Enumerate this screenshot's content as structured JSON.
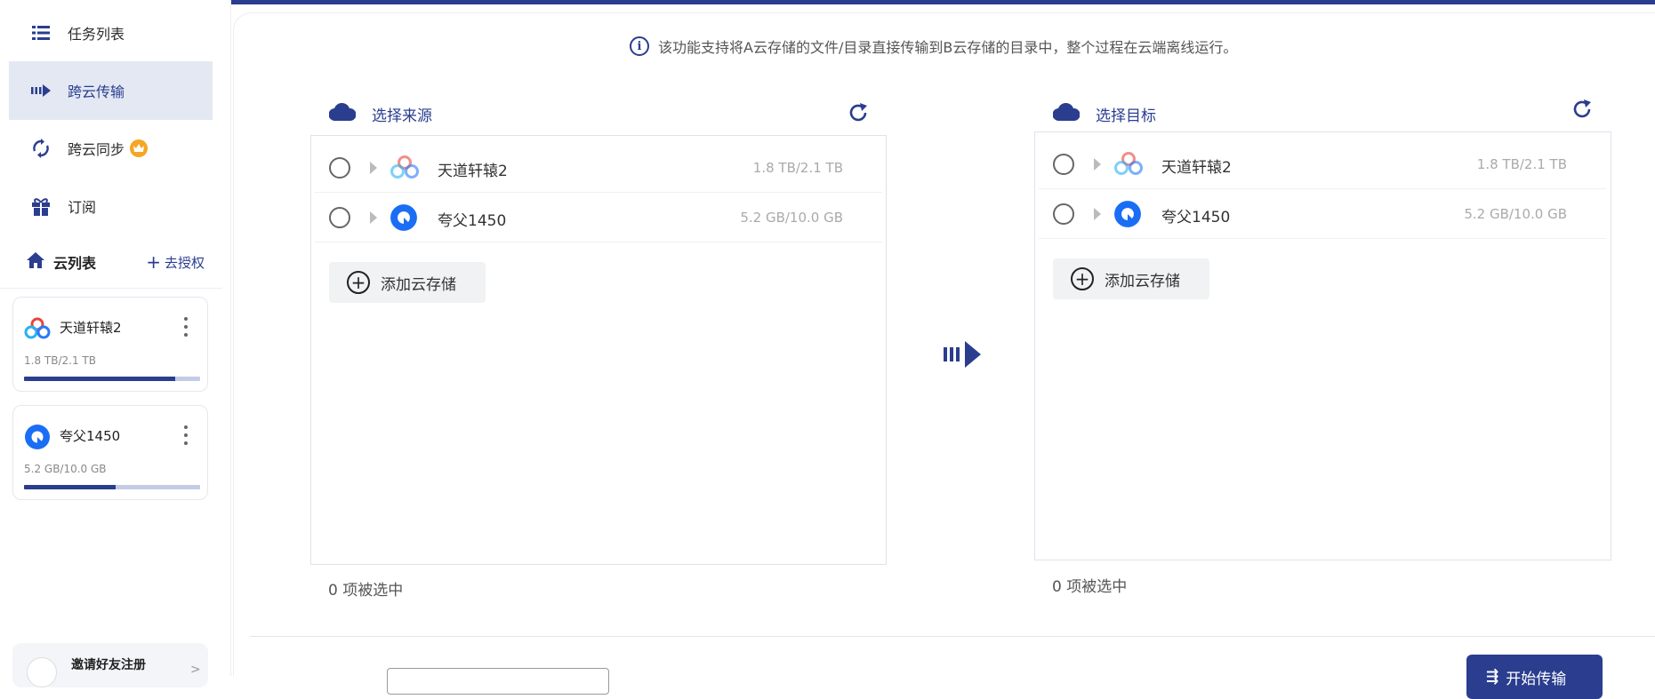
{
  "sidebar": {
    "nav": [
      {
        "label": "任务列表",
        "icon": "task-list-icon"
      },
      {
        "label": "跨云传输",
        "icon": "transfer-icon",
        "active": true
      },
      {
        "label": "跨云同步",
        "icon": "sync-icon",
        "badge": "crown-icon"
      },
      {
        "label": "订阅",
        "icon": "gift-icon"
      }
    ],
    "cloud_list": {
      "title": "云列表",
      "auth_link": "去授权"
    },
    "cards": [
      {
        "name": "天道轩辕2",
        "usage": "1.8 TB/2.1 TB",
        "fill": 0.86,
        "icon": "baidu-cloud-logo-icon"
      },
      {
        "name": "夸父1450",
        "usage": "5.2 GB/10.0 GB",
        "fill": 0.52,
        "icon": "quark-logo-icon"
      }
    ],
    "invite": {
      "label": "邀请好友注册"
    }
  },
  "main": {
    "notice": "该功能支持将A云存储的文件/目录直接传输到B云存储的目录中，整个过程在云端离线运行。",
    "source": {
      "title": "选择来源",
      "items": [
        {
          "name": "天道轩辕2",
          "capacity": "1.8 TB/2.1 TB"
        },
        {
          "name": "夸父1450",
          "capacity": "5.2 GB/10.0 GB"
        }
      ],
      "add_label": "添加云存储",
      "selected_count": "0 项被选中"
    },
    "target": {
      "title": "选择目标",
      "items": [
        {
          "name": "天道轩辕2",
          "capacity": "1.8 TB/2.1 TB"
        },
        {
          "name": "夸父1450",
          "capacity": "5.2 GB/10.0 GB"
        }
      ],
      "add_label": "添加云存储",
      "selected_count": "0 项被选中"
    },
    "start_button": "开始传输"
  },
  "colors": {
    "accent": "#2a3d8f",
    "active_bg": "#e4e8f3",
    "crown": "#f5a623",
    "quark_blue": "#1a6ef5"
  }
}
